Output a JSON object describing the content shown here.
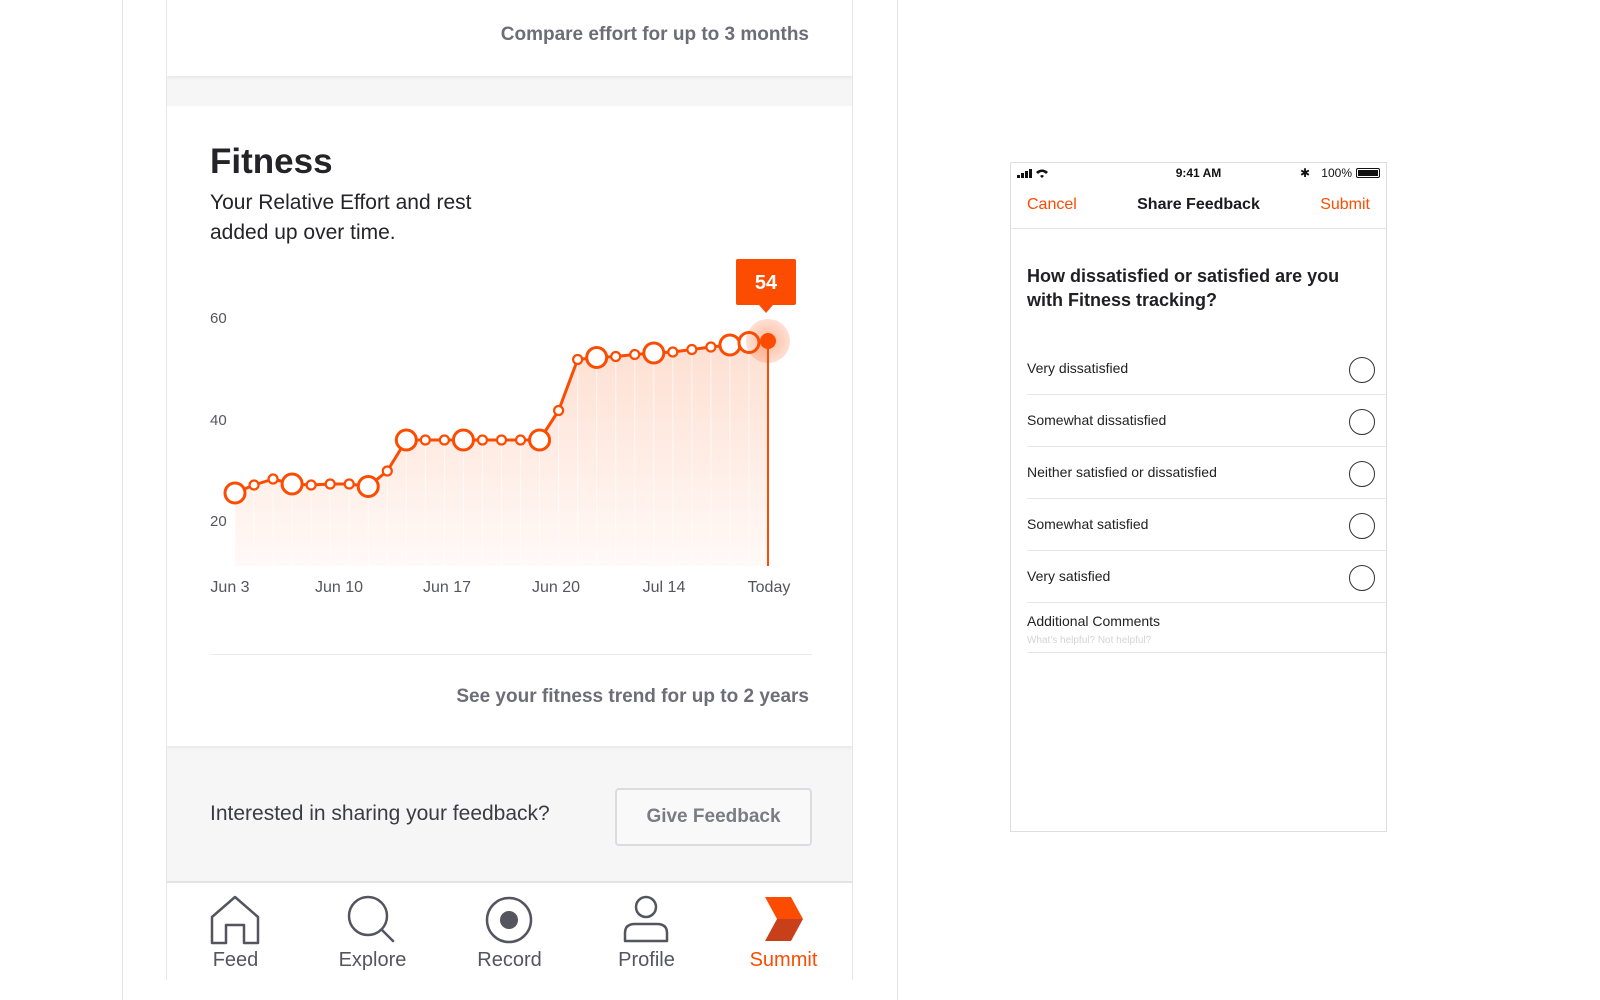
{
  "left_screen": {
    "compare_link": "Compare effort for up to 3 months",
    "fitness": {
      "title": "Fitness",
      "subtitle": "Your Relative Effort and rest added up over time.",
      "tooltip_value": "54",
      "trend_link": "See your fitness trend for up to 2 years"
    },
    "feedback": {
      "prompt": "Interested in sharing your feedback?",
      "button_label": "Give Feedback"
    },
    "tabs": [
      {
        "label": "Feed",
        "icon": "home-icon"
      },
      {
        "label": "Explore",
        "icon": "search-icon"
      },
      {
        "label": "Record",
        "icon": "record-icon"
      },
      {
        "label": "Profile",
        "icon": "profile-icon"
      },
      {
        "label": "Summit",
        "icon": "summit-icon",
        "active": true
      }
    ],
    "accent_color": "#fc4c02"
  },
  "chart_data": {
    "type": "line",
    "title": "",
    "xlabel": "",
    "ylabel": "",
    "x_tick_labels": [
      "Jun 3",
      "Jun 10",
      "Jun 17",
      "Jun 20",
      "Jul 14",
      "Today"
    ],
    "y_tick_labels": [
      "20",
      "40",
      "60"
    ],
    "ylim": [
      18,
      62
    ],
    "grid": false,
    "series": [
      {
        "values": [
          23,
          24.6,
          25.8,
          24.8,
          24.6,
          24.8,
          24.8,
          24.3,
          27.4,
          33.6,
          33.6,
          33.6,
          33.6,
          33.6,
          33.6,
          33.6,
          33.6,
          39.5,
          49.7,
          50.1,
          50.3,
          50.7,
          51,
          51.2,
          51.7,
          52.2,
          52.6,
          53.1,
          53.4
        ],
        "emphasized_points": [
          0,
          3,
          7,
          9,
          12,
          16,
          19,
          22,
          26,
          27,
          28
        ],
        "highlighted_last": true
      }
    ]
  },
  "modal": {
    "status_time": "9:41 AM",
    "battery": "100%",
    "bluetooth_glyph": "✱",
    "nav": {
      "cancel": "Cancel",
      "title": "Share Feedback",
      "submit": "Submit"
    },
    "question": "How dissatisfied or satisfied are you with Fitness tracking?",
    "options": [
      "Very dissatisfied",
      "Somewhat dissatisfied",
      "Neither satisfied or dissatisfied",
      "Somewhat satisfied",
      "Very satisfied"
    ],
    "comments_label": "Additional Comments",
    "comments_placeholder": "What's helpful? Not helpful?"
  }
}
